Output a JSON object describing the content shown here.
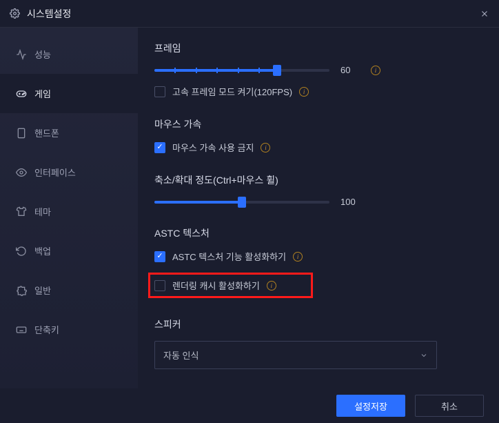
{
  "window": {
    "title": "시스템설정"
  },
  "sidebar": {
    "items": [
      {
        "label": "성능"
      },
      {
        "label": "게임"
      },
      {
        "label": "핸드폰"
      },
      {
        "label": "인터페이스"
      },
      {
        "label": "테마"
      },
      {
        "label": "백업"
      },
      {
        "label": "일반"
      },
      {
        "label": "단축키"
      }
    ]
  },
  "frame": {
    "title": "프레임",
    "value": "60",
    "percent": 70,
    "highspeed_label": "고속 프레임 모드 켜기(120FPS)",
    "highspeed_checked": false
  },
  "mouse": {
    "title": "마우스 가속",
    "disable_label": "마우스 가속 사용 금지",
    "disable_checked": true
  },
  "zoom": {
    "title": "축소/확대 정도(Ctrl+마우스 휠)",
    "value": "100",
    "percent": 50
  },
  "astc": {
    "title": "ASTC 텍스처",
    "enable_label": "ASTC 텍스처 기능 활성화하기",
    "enable_checked": true,
    "render_cache_label": "렌더링 캐시 활성화하기",
    "render_cache_checked": false
  },
  "speaker": {
    "title": "스피커",
    "selected": "자동 인식"
  },
  "footer": {
    "save": "설정저장",
    "cancel": "취소"
  },
  "chart_data": {
    "type": "table",
    "title": "시스템설정 Game Settings",
    "sliders": [
      {
        "name": "프레임",
        "value": 60,
        "visual_percent": 70
      },
      {
        "name": "축소/확대 정도(Ctrl+마우스 휠)",
        "value": 100,
        "visual_percent": 50
      }
    ],
    "toggles": [
      {
        "name": "고속 프레임 모드 켜기(120FPS)",
        "checked": false
      },
      {
        "name": "마우스 가속 사용 금지",
        "checked": true
      },
      {
        "name": "ASTC 텍스처 기능 활성화하기",
        "checked": true
      },
      {
        "name": "렌더링 캐시 활성화하기",
        "checked": false
      }
    ],
    "selects": [
      {
        "name": "스피커",
        "value": "자동 인식"
      }
    ]
  }
}
